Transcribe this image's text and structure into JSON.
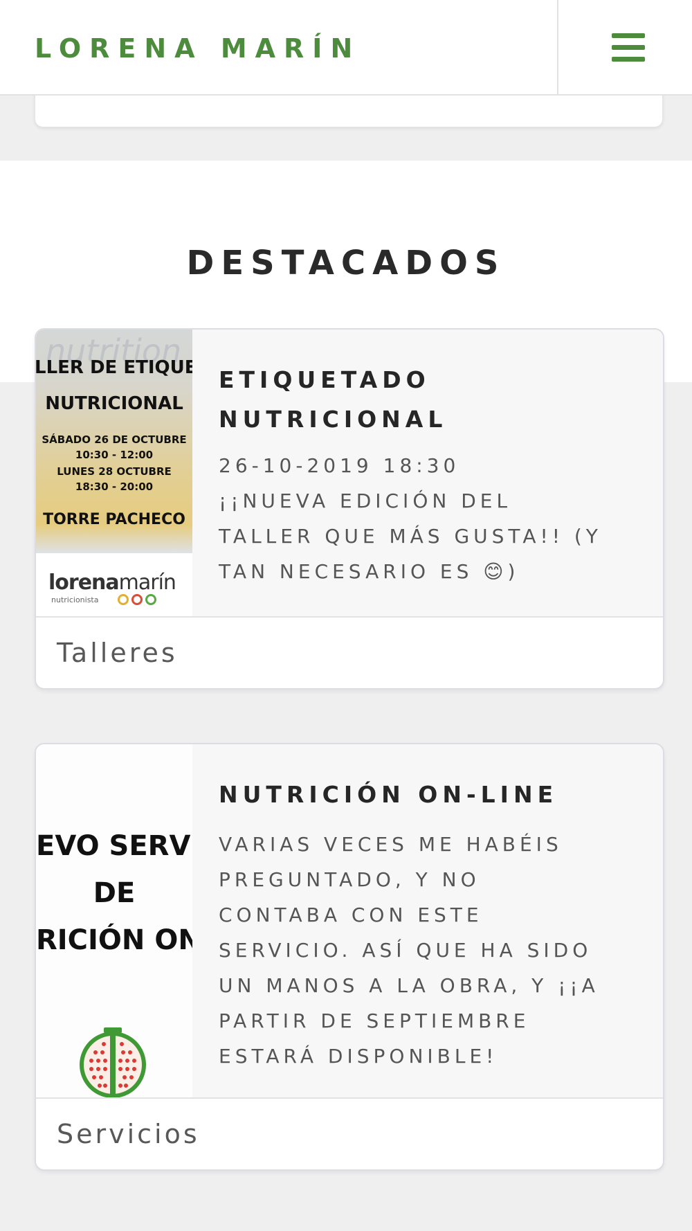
{
  "header": {
    "brand": "LORENA MARÍN",
    "menu_icon": "hamburger-icon",
    "accent": "#4c8c3c"
  },
  "section": {
    "title": "DESTACADOS"
  },
  "cards": [
    {
      "title_line1": "ETIQUETADO",
      "title_line2": "NUTRICIONAL",
      "date": "26-10-2019 18:30",
      "text_lines": [
        "¡¡NUEVA EDICIÓN DEL",
        "TALLER QUE MÁS GUSTA!! (Y",
        "TAN NECESARIO ES 😊)"
      ],
      "category": "Talleres",
      "image": {
        "watermark": "nutrition",
        "lines": [
          "LLER DE ETIQUETA",
          "NUTRICIONAL",
          "SÁBADO 26 DE OCTUBRE",
          "10:30 - 12:00",
          "LUNES 28 OCTUBRE",
          "18:30 - 20:00",
          "TORRE PACHECO"
        ],
        "logo_a": "lorena",
        "logo_b": "marín",
        "logo_sub": "nutricionista"
      }
    },
    {
      "title": "NUTRICIÓN ON-LINE",
      "text_lines": [
        "VARIAS VECES ME HABÉIS",
        "PREGUNTADO, Y NO",
        "CONTABA CON ESTE",
        "SERVICIO. ASÍ QUE HA SIDO",
        "UN MANOS A LA OBRA, Y ¡¡A",
        "PARTIR DE SEPTIEMBRE",
        "ESTARÁ DISPONIBLE!"
      ],
      "category": "Servicios",
      "image": {
        "lines": [
          "EVO SERVIC",
          "DE",
          "RICIÓN ONL"
        ],
        "icon": "pomegranate-icon"
      }
    }
  ]
}
